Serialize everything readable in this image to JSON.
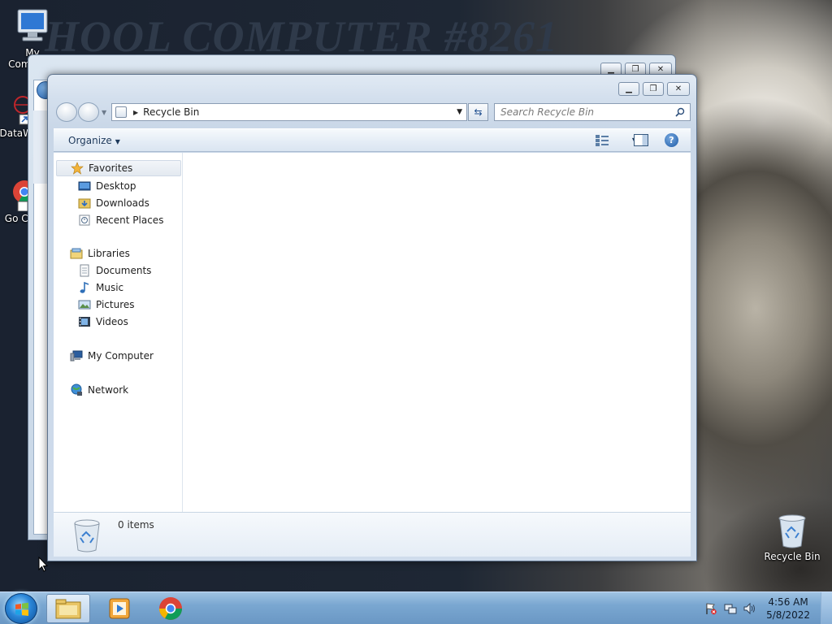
{
  "wallpaper": {
    "title": "HOOL COMPUTER #8261"
  },
  "desktop": {
    "icons": [
      {
        "label": "My Computer",
        "icon": "computer-icon"
      },
      {
        "label": "DataW",
        "icon": "shortcut-icon"
      },
      {
        "label": "Go Ch",
        "icon": "chrome-icon"
      },
      {
        "label": "Recycle Bin",
        "icon": "recycle-bin-icon"
      }
    ]
  },
  "explorer": {
    "address": {
      "location": "Recycle Bin"
    },
    "search": {
      "placeholder": "Search Recycle Bin"
    },
    "commands": {
      "organize": "Organize"
    },
    "nav_pane": {
      "favorites": {
        "label": "Favorites",
        "items": [
          "Desktop",
          "Downloads",
          "Recent Places"
        ]
      },
      "libraries": {
        "label": "Libraries",
        "items": [
          "Documents",
          "Music",
          "Pictures",
          "Videos"
        ]
      },
      "computer": {
        "label": "My Computer"
      },
      "network": {
        "label": "Network"
      }
    },
    "details": {
      "item_count": "0 items"
    }
  },
  "taskbar": {
    "pinned": [
      "windows-explorer-icon",
      "media-player-icon",
      "chrome-icon"
    ],
    "clock": {
      "time": "4:56 AM",
      "date": "5/8/2022"
    },
    "tray": [
      "action-center-flag-icon",
      "network-icon",
      "volume-icon"
    ]
  },
  "colors": {
    "taskbar": "#7aa7d1",
    "window_frame": "#c8d6e7",
    "accent": "#1d5aa6"
  }
}
